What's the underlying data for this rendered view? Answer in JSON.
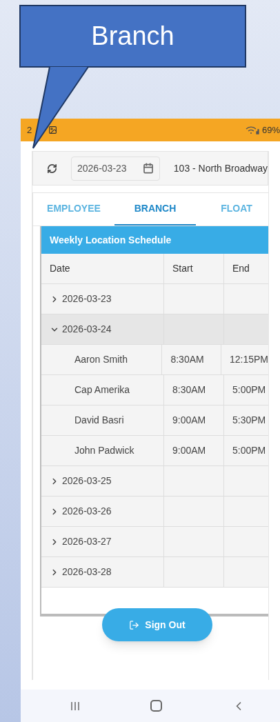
{
  "callout": {
    "text": "Branch"
  },
  "status_bar": {
    "time": "2",
    "battery": "69%"
  },
  "toolbar": {
    "date": "2026-03-23",
    "branch": "103 - North Broadway"
  },
  "tabs": [
    {
      "label": "EMPLOYEE",
      "selected": false
    },
    {
      "label": "BRANCH",
      "selected": true
    },
    {
      "label": "FLOAT",
      "selected": false
    }
  ],
  "schedule": {
    "title": "Weekly Location Schedule",
    "columns": [
      "Date",
      "Start",
      "End"
    ],
    "rows": [
      {
        "date": "2026-03-23",
        "expanded": false
      },
      {
        "date": "2026-03-24",
        "expanded": true,
        "children": [
          {
            "name": "Aaron Smith",
            "start": "8:30AM",
            "end": "12:15PM"
          },
          {
            "name": "Cap Amerika",
            "start": "8:30AM",
            "end": "5:00PM"
          },
          {
            "name": "David Basri",
            "start": "9:00AM",
            "end": "5:30PM"
          },
          {
            "name": "John Padwick",
            "start": "9:00AM",
            "end": "5:00PM"
          }
        ]
      },
      {
        "date": "2026-03-25",
        "expanded": false
      },
      {
        "date": "2026-03-26",
        "expanded": false
      },
      {
        "date": "2026-03-27",
        "expanded": false
      },
      {
        "date": "2026-03-28",
        "expanded": false
      }
    ]
  },
  "sign_out": {
    "label": "Sign Out"
  }
}
